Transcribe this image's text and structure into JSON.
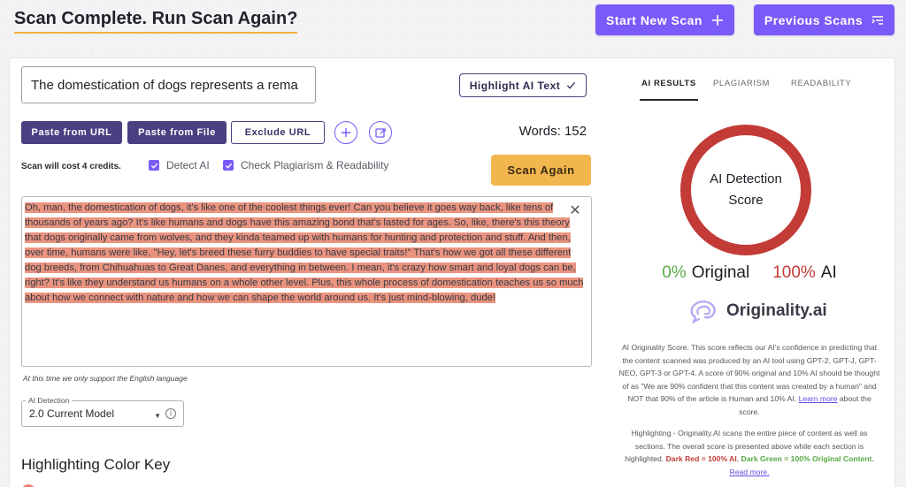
{
  "header": {
    "title": "Scan Complete. Run Scan Again?",
    "start_new_scan": "Start New Scan",
    "previous_scans": "Previous Scans"
  },
  "editor": {
    "title_value": "The domestication of dogs represents a rema",
    "highlight_ai_text": "Highlight AI Text",
    "paste_from_url": "Paste from URL",
    "paste_from_file": "Paste from File",
    "exclude_url": "Exclude URL",
    "words_label": "Words: 152",
    "cost_text": "Scan will cost 4 credits.",
    "detect_ai_label": "Detect AI",
    "check_plagiarism_label": "Check Plagiarism & Readability",
    "scan_again": "Scan Again",
    "content": "Oh, man, the domestication of dogs, it's like one of the coolest things ever! Can you believe it goes way back, like tens of thousands of years ago? It's like humans and dogs have this amazing bond that's lasted for ages. So, like, there's this theory that dogs originally came from wolves, and they kinda teamed up with humans for hunting and protection and stuff. And then, over time, humans were like, \"Hey, let's breed these furry buddies to have special traits!\" That's how we got all these different dog breeds, from Chihuahuas to Great Danes, and everything in between. I mean, it's crazy how smart and loyal dogs can be, right? It's like they understand us humans on a whole other level. Plus, this whole process of domestication teaches us so much about how we connect with nature and how we can shape the world around us. It's just mind-blowing, dude!",
    "language_note": "At this time we only support the English language",
    "model_legend": "AI Detection",
    "model_value": "2.0 Current Model",
    "color_key_title": "Highlighting Color Key"
  },
  "results": {
    "tabs": [
      "AI RESULTS",
      "PLAGIARISM",
      "READABILITY"
    ],
    "score_label": "AI Detection Score",
    "original_pct": "0%",
    "original_label": "Original",
    "ai_pct": "100%",
    "ai_label": "AI",
    "logo_text": "Originality.ai",
    "description": "AI Originality Score. This score reflects our AI's confidence in predicting that the content scanned was produced by an AI tool using GPT-2, GPT-J, GPT-NEO, GPT-3 or GPT-4. A score of 90% original and 10% AI should be thought of as \"We are 90% confident that this content was created by a human\" and NOT that 90% of the article is Human and 10% AI.",
    "learn_more": "Learn more",
    "learn_more_suffix": " about the score.",
    "highlight_desc": "Highlighting - Originality.AI scans the entire piece of content as well as sections. The overall score is presented above while each section is highlighted. ",
    "dark_red_text": "Dark Red = 100% AI",
    "dark_green_text": "Dark Green = 100% Original Content.",
    "read_more": "Read more."
  },
  "colors": {
    "accent": "#7a5af8",
    "dark_button": "#4b3f82",
    "scan_button": "#f2b64f",
    "ai_red": "#c23b36",
    "original_green": "#57a845",
    "highlight": "#ea9480"
  },
  "icons": [
    "plus-icon",
    "list-icon",
    "check-icon",
    "add-circle-icon",
    "export-icon",
    "close-icon",
    "chevron-down-icon",
    "info-icon",
    "brain-logo-icon"
  ]
}
